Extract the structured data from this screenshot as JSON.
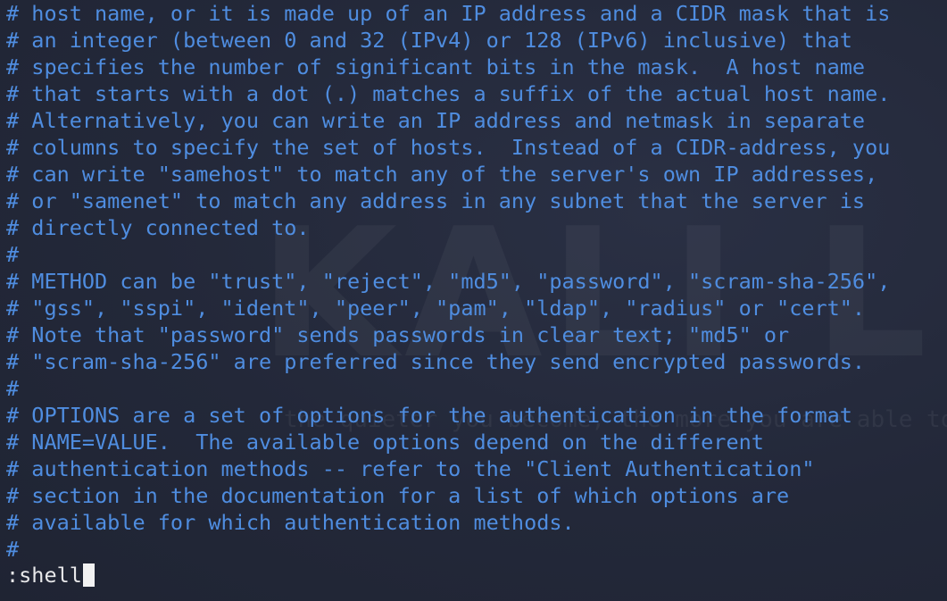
{
  "watermark": {
    "text": "KALI LINUX",
    "tagline": "the quieter you become, the more you are able to hear"
  },
  "file_lines": [
    "# host name, or it is made up of an IP address and a CIDR mask that is",
    "# an integer (between 0 and 32 (IPv4) or 128 (IPv6) inclusive) that",
    "# specifies the number of significant bits in the mask.  A host name",
    "# that starts with a dot (.) matches a suffix of the actual host name.",
    "# Alternatively, you can write an IP address and netmask in separate",
    "# columns to specify the set of hosts.  Instead of a CIDR-address, you",
    "# can write \"samehost\" to match any of the server's own IP addresses,",
    "# or \"samenet\" to match any address in any subnet that the server is",
    "# directly connected to.",
    "#",
    "# METHOD can be \"trust\", \"reject\", \"md5\", \"password\", \"scram-sha-256\",",
    "# \"gss\", \"sspi\", \"ident\", \"peer\", \"pam\", \"ldap\", \"radius\" or \"cert\".",
    "# Note that \"password\" sends passwords in clear text; \"md5\" or",
    "# \"scram-sha-256\" are preferred since they send encrypted passwords.",
    "#",
    "# OPTIONS are a set of options for the authentication in the format",
    "# NAME=VALUE.  The available options depend on the different",
    "# authentication methods -- refer to the \"Client Authentication\"",
    "# section in the documentation for a list of which options are",
    "# available for which authentication methods.",
    "#"
  ],
  "command_line": {
    "text": ":shell"
  },
  "colors": {
    "comment": "#4f8de0",
    "command": "#e8e8ea",
    "cursor": "#f2f2f2",
    "background": "#23283a"
  }
}
